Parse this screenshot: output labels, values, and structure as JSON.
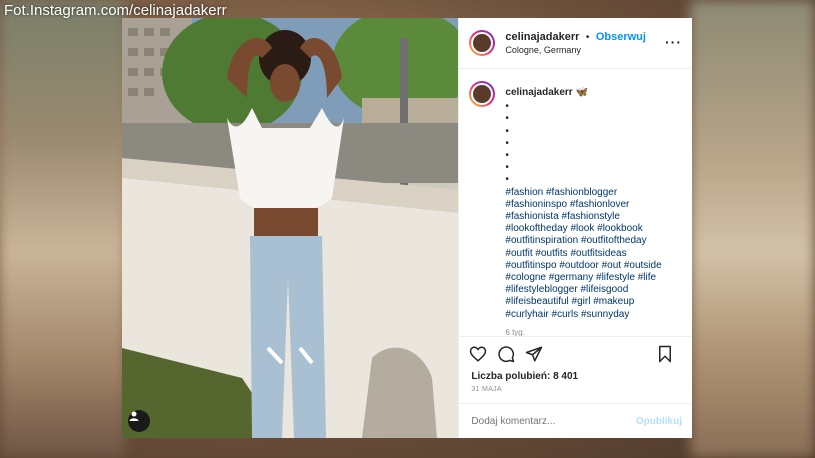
{
  "watermark": "Fot.Instagram.com/celinajadakerr",
  "header": {
    "username": "celinajadakerr",
    "separator": "•",
    "follow_label": "Obserwuj",
    "location": "Cologne, Germany",
    "more_icon": "more-horizontal-icon"
  },
  "caption": {
    "username": "celinajadakerr",
    "emoji": "🦋",
    "bullets": [
      "•",
      "•",
      "•",
      "•",
      "•",
      "•",
      "•"
    ],
    "hashtags": [
      "#fashion #fashionblogger",
      "#fashioninspo #fashionlover",
      "#fashionista #fashionstyle",
      "#lookoftheday #look #lookbook",
      "#outfitinspiration #outfitoftheday",
      "#outfit #outfits #outfitsideas",
      "#outfitinspo #outdoor #out #outside",
      "#cologne #germany #lifestyle #life",
      "#lifestyleblogger #lifeisgood",
      "#lifeisbeautiful #girl #makeup",
      "#curlyhair #curls #sunnyday"
    ],
    "time_ago": "6 tyg."
  },
  "actions": {
    "like_icon": "heart-icon",
    "comment_icon": "comment-icon",
    "share_icon": "share-icon",
    "save_icon": "bookmark-icon"
  },
  "likes_text": "Liczba polubień: 8 401",
  "date_text": "31 MAJA",
  "comment": {
    "placeholder": "Dodaj komentarz...",
    "publish_label": "Opublikuj"
  },
  "colors": {
    "link_blue": "#0095f6",
    "hashtag": "#00376b",
    "publish_disabled": "#b2dffc"
  }
}
